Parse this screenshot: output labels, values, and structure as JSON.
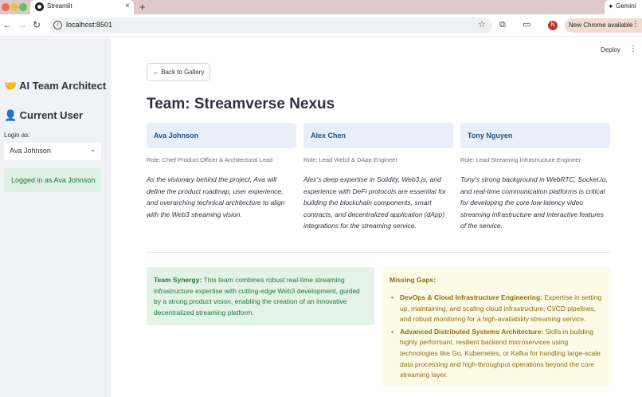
{
  "browser": {
    "tab_title": "Streamlit",
    "tab_close": "×",
    "new_tab": "+",
    "gemini_label": "Gemini",
    "url": "localhost:8501",
    "profile_initial": "N",
    "update_label": "New Chrome available",
    "icons": {
      "back": "←",
      "forward": "→",
      "reload": "↻",
      "info": "i",
      "star": "☆",
      "puzzle": "⧉",
      "cast": "▭",
      "gemini": "✦",
      "menu": "⋮"
    }
  },
  "sidebar": {
    "title_emoji": "🤝",
    "title": "AI Team Architect",
    "user_emoji": "👤",
    "user_heading": "Current User",
    "login_label": "Login as:",
    "login_value": "Ava Johnson",
    "login_chevron": "⌄",
    "status": "Logged in as Ava Johnson"
  },
  "header": {
    "deploy": "Deploy",
    "menu": "⋮"
  },
  "main": {
    "back_button": "← Back to Gallery",
    "team_title": "Team: Streamverse Nexus",
    "members": [
      {
        "name": "Ava Johnson",
        "role": "Role: Chief Product Officer & Architectural Lead",
        "description": "As the visionary behind the project, Ava will define the product roadmap, user experience, and overarching technical architecture to align with the Web3 streaming vision."
      },
      {
        "name": "Alex Chen",
        "role": "Role: Lead Web3 & DApp Engineer",
        "description": "Alex's deep expertise in Solidity, Web3.js, and experience with DeFi protocols are essential for building the blockchain components, smart contracts, and decentralized application (dApp) integrations for the streaming service."
      },
      {
        "name": "Tony Nguyen",
        "role": "Role: Lead Streaming Infrastructure Engineer",
        "description": "Tony's strong background in WebRTC, Socket.io, and real-time communication platforms is critical for developing the core low-latency video streaming infrastructure and interactive features of the service."
      }
    ],
    "synergy": {
      "label": "Team Synergy:",
      "text": " This team combines robust real-time streaming infrastructure expertise with cutting-edge Web3 development, guided by a strong product vision, enabling the creation of an innovative decentralized streaming platform."
    },
    "gaps": {
      "title": "Missing Gaps:",
      "bullet": "•",
      "items": [
        {
          "label": "DevOps & Cloud Infrastructure Engineering:",
          "text": " Expertise in setting up, maintaining, and scaling cloud infrastructure, CI/CD pipelines, and robust monitoring for a high-availability streaming service."
        },
        {
          "label": "Advanced Distributed Systems Architecture:",
          "text": " Skills in building highly performant, resilient backend microservices using technologies like Go, Kubernetes, or Kafka for handling large-scale data processing and high-throughput operations beyond the core streaming layer."
        }
      ]
    }
  },
  "colors": {
    "sidebar_bg": "#f0f2f6",
    "success_bg": "#dff0e4",
    "success_text": "#1d7a3a",
    "member_card_bg": "#e8effb",
    "member_name": "#1f4e8a",
    "warning_bg": "#fdfbe6",
    "warning_text": "#8a6d14",
    "tabbar_bg": "#dfc8c8"
  }
}
